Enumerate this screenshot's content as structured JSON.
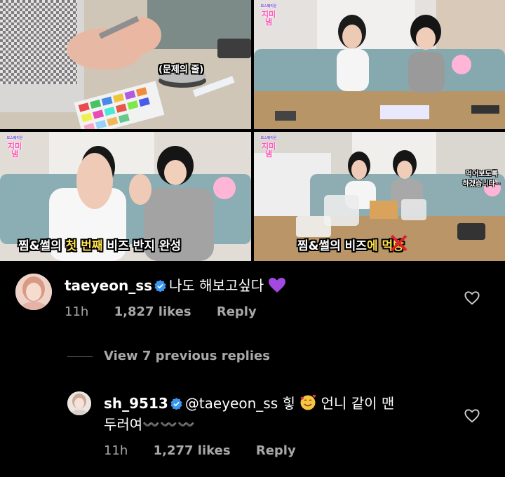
{
  "panels": [
    {
      "logo_small": "",
      "logo": "",
      "caption": "(문제의 줄)"
    },
    {
      "logo_small": "보스웨이온",
      "logo": "지미냄"
    },
    {
      "logo_small": "보스웨이온",
      "logo": "지미냄",
      "caption_pre": "찜&썰의 ",
      "caption_hl": "첫 번째",
      "caption_post": " 비즈 반지 완성"
    },
    {
      "logo_small": "보스웨이온",
      "logo": "지미냄",
      "caption_pre": "찜&썰의 ",
      "caption_mid": "비즈",
      "caption_x": "✕",
      "caption_post_hl": "에 먹방",
      "side_caption_1": "먹어보도록",
      "side_caption_2": "하겠습니다~"
    }
  ],
  "comments": [
    {
      "username": "taeyeon_ss",
      "text": "나도 해보고싶다",
      "emoji": "purple-heart",
      "time": "11h",
      "likes": "1,827 likes",
      "reply": "Reply"
    },
    {
      "username": "sh_9513",
      "mention": "@taeyeon_ss",
      "text_1": "힣",
      "emoji": "smiling-face-with-hearts",
      "text_2": "언니 같이 맨",
      "text_line2": "두러여〰️〰️〰️",
      "time": "11h",
      "likes": "1,277 likes",
      "reply": "Reply"
    }
  ],
  "view_previous": "View 7 previous replies",
  "colors": {
    "background": "#000000",
    "meta_gray": "#a8a8a8",
    "verified_blue": "#3897f0"
  }
}
